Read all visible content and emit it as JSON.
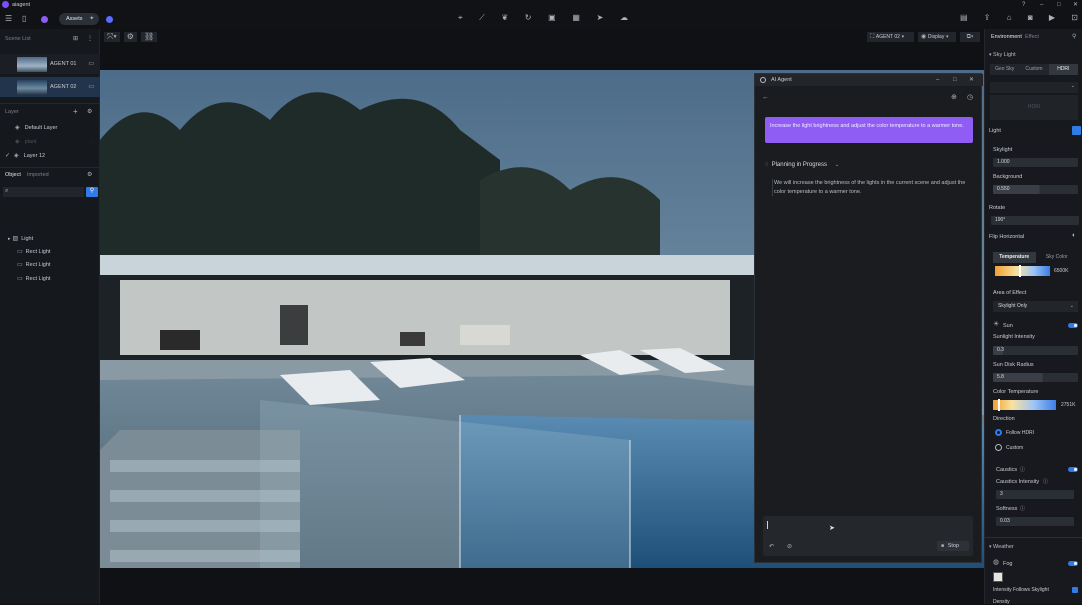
{
  "app": {
    "title": "aiagent",
    "assets_label": "Assets"
  },
  "toolbar_icons": [
    "pin-icon",
    "path-icon",
    "leaf-icon",
    "rotate-icon",
    "box-icon",
    "grid-icon",
    "cursor-icon",
    "cloud-icon"
  ],
  "left": {
    "scene_list_title": "Scene List",
    "scenes": [
      {
        "label": "AGENT 01"
      },
      {
        "label": "AGENT 02"
      }
    ],
    "layer_title": "Layer",
    "layers": [
      {
        "label": "Default Layer"
      },
      {
        "label": "plant"
      },
      {
        "label": "Layer 12"
      }
    ],
    "tabs": {
      "object": "Object",
      "imported": "Imported"
    },
    "objects": [
      {
        "label": "Light"
      },
      {
        "label": "Rect Light"
      },
      {
        "label": "Rect Light"
      },
      {
        "label": "Rect Light"
      }
    ]
  },
  "viewport_bar": {
    "camera": "AGENT 02",
    "display": "Display"
  },
  "agent": {
    "title": "AI Agent",
    "user_message": "Increase the light brightness and adjust the color temperature to a warmer tone.",
    "status": "Planning in Progress",
    "reply": "We will increase the brightness of the lights in the current scene and adjust the color temperature to a warmer tone.",
    "input_value": "",
    "stop_label": "Stop"
  },
  "right": {
    "tabs": {
      "environment": "Environment",
      "effect": "Effect"
    },
    "sky_light": "Sky Light",
    "sky_tabs": [
      "Geo Sky",
      "Custom",
      "HDRI"
    ],
    "hdri_label": "HDRI",
    "light": "Light",
    "skylight_label": "Skylight",
    "skylight_value": "1.000",
    "background_label": "Background",
    "background_value": "0.550",
    "rotate_label": "Rotate",
    "rotate_value": "190°",
    "flip_label": "Flip Horizontal",
    "temp_tabs": [
      "Temperature",
      "Sky Color"
    ],
    "temp_value": "6500K",
    "area_label": "Area of Effect",
    "area_value": "Skylight Only",
    "sun_label": "Sun",
    "sun_intensity_label": "Sunlight Intensity",
    "sun_intensity_value": "0.3",
    "sun_disk_label": "Sun Disk Radius",
    "sun_disk_value": "5.8",
    "color_temp_label": "Color Temperature",
    "color_temp_value": "2751K",
    "direction_label": "Direction",
    "direction_options": [
      "Follow HDRI",
      "Custom"
    ],
    "caustics_label": "Caustics",
    "caustics_intensity_label": "Caustics Intensity",
    "caustics_intensity_value": "3",
    "softness_label": "Softness",
    "softness_value": "0.03",
    "weather_label": "Weather",
    "fog_label": "Fog",
    "intensity_follows_label": "Intensity Follows Skylight",
    "density_label": "Density"
  },
  "colors": {
    "accent": "#2f7be8",
    "purple": "#8b5cf6"
  }
}
